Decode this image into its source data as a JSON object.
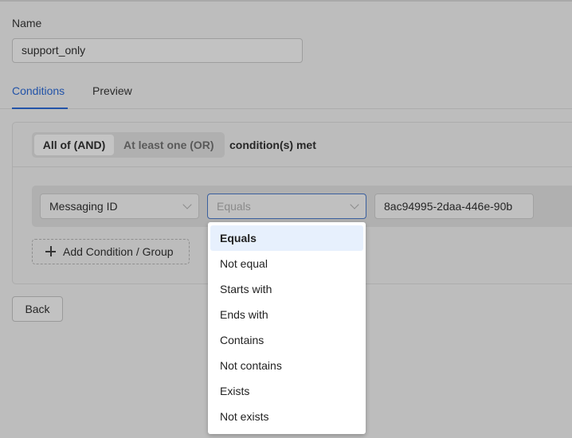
{
  "form": {
    "name_label": "Name",
    "name_value": "support_only"
  },
  "tabs": [
    {
      "label": "Conditions",
      "active": true
    },
    {
      "label": "Preview",
      "active": false
    }
  ],
  "logic": {
    "and_label": "All of (AND)",
    "or_label": "At least one (OR)",
    "suffix": "condition(s) met",
    "selected": "All of (AND)"
  },
  "condition": {
    "field": "Messaging ID",
    "operator_placeholder": "Equals",
    "value": "8ac94995-2daa-446e-90b"
  },
  "add_condition_label": "Add Condition / Group",
  "back_label": "Back",
  "operator_dropdown": {
    "options": [
      "Equals",
      "Not equal",
      "Starts with",
      "Ends with",
      "Contains",
      "Not contains",
      "Exists",
      "Not exists"
    ],
    "highlighted": "Equals"
  },
  "colors": {
    "accent": "#2253a8",
    "highlight": "#e7f0fd"
  },
  "icons": [
    "chevron-down-icon",
    "plus-icon"
  ]
}
